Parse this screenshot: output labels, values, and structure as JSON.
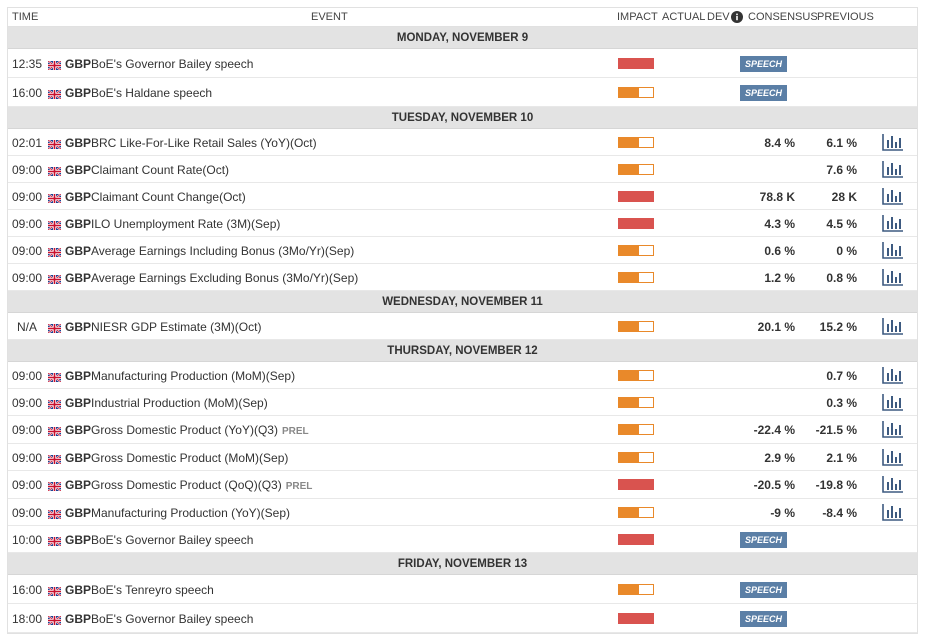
{
  "columns": {
    "time": "TIME",
    "event": "EVENT",
    "impact": "IMPACT",
    "actual": "ACTUAL",
    "dev": "DEV",
    "consensus": "CONSENSUS",
    "previous": "PREVIOUS"
  },
  "colors": {
    "impact_medium": "#e9892a",
    "impact_high": "#d9534f",
    "speech_badge": "#5b7fa6",
    "chart_icon": "#3d5a80",
    "day_header_bg": "#e3e3e3"
  },
  "groups": [
    {
      "day": "MONDAY, NOVEMBER 9",
      "events": [
        {
          "time": "12:35",
          "currency": "GBP",
          "name": "BoE's Governor Bailey speech",
          "tag": "",
          "impact": "high",
          "speech": "SPEECH",
          "consensus": "",
          "previous": "",
          "chart": false
        },
        {
          "time": "16:00",
          "currency": "GBP",
          "name": "BoE's Haldane speech",
          "tag": "",
          "impact": "medium",
          "speech": "SPEECH",
          "consensus": "",
          "previous": "",
          "chart": false
        }
      ]
    },
    {
      "day": "TUESDAY, NOVEMBER 10",
      "events": [
        {
          "time": "02:01",
          "currency": "GBP",
          "name": "BRC Like-For-Like Retail Sales (YoY)(Oct)",
          "tag": "",
          "impact": "medium",
          "speech": "",
          "consensus": "8.4 %",
          "previous": "6.1 %",
          "chart": true
        },
        {
          "time": "09:00",
          "currency": "GBP",
          "name": "Claimant Count Rate(Oct)",
          "tag": "",
          "impact": "medium",
          "speech": "",
          "consensus": "",
          "previous": "7.6 %",
          "chart": true
        },
        {
          "time": "09:00",
          "currency": "GBP",
          "name": "Claimant Count Change(Oct)",
          "tag": "",
          "impact": "high",
          "speech": "",
          "consensus": "78.8 K",
          "previous": "28 K",
          "chart": true
        },
        {
          "time": "09:00",
          "currency": "GBP",
          "name": "ILO Unemployment Rate (3M)(Sep)",
          "tag": "",
          "impact": "high",
          "speech": "",
          "consensus": "4.3 %",
          "previous": "4.5 %",
          "chart": true
        },
        {
          "time": "09:00",
          "currency": "GBP",
          "name": "Average Earnings Including Bonus (3Mo/Yr)(Sep)",
          "tag": "",
          "impact": "medium",
          "speech": "",
          "consensus": "0.6 %",
          "previous": "0 %",
          "chart": true
        },
        {
          "time": "09:00",
          "currency": "GBP",
          "name": "Average Earnings Excluding Bonus (3Mo/Yr)(Sep)",
          "tag": "",
          "impact": "medium",
          "speech": "",
          "consensus": "1.2 %",
          "previous": "0.8 %",
          "chart": true
        }
      ]
    },
    {
      "day": "WEDNESDAY, NOVEMBER 11",
      "events": [
        {
          "time": "N/A",
          "currency": "GBP",
          "name": "NIESR GDP Estimate (3M)(Oct)",
          "tag": "",
          "impact": "medium",
          "speech": "",
          "consensus": "20.1 %",
          "previous": "15.2 %",
          "chart": true
        }
      ]
    },
    {
      "day": "THURSDAY, NOVEMBER 12",
      "events": [
        {
          "time": "09:00",
          "currency": "GBP",
          "name": "Manufacturing Production (MoM)(Sep)",
          "tag": "",
          "impact": "medium",
          "speech": "",
          "consensus": "",
          "previous": "0.7 %",
          "chart": true
        },
        {
          "time": "09:00",
          "currency": "GBP",
          "name": "Industrial Production (MoM)(Sep)",
          "tag": "",
          "impact": "medium",
          "speech": "",
          "consensus": "",
          "previous": "0.3 %",
          "chart": true
        },
        {
          "time": "09:00",
          "currency": "GBP",
          "name": "Gross Domestic Product (YoY)(Q3)",
          "tag": "PREL",
          "impact": "medium",
          "speech": "",
          "consensus": "-22.4 %",
          "previous": "-21.5 %",
          "chart": true
        },
        {
          "time": "09:00",
          "currency": "GBP",
          "name": "Gross Domestic Product (MoM)(Sep)",
          "tag": "",
          "impact": "medium",
          "speech": "",
          "consensus": "2.9 %",
          "previous": "2.1 %",
          "chart": true
        },
        {
          "time": "09:00",
          "currency": "GBP",
          "name": "Gross Domestic Product (QoQ)(Q3)",
          "tag": "PREL",
          "impact": "high",
          "speech": "",
          "consensus": "-20.5 %",
          "previous": "-19.8 %",
          "chart": true
        },
        {
          "time": "09:00",
          "currency": "GBP",
          "name": "Manufacturing Production (YoY)(Sep)",
          "tag": "",
          "impact": "medium",
          "speech": "",
          "consensus": "-9 %",
          "previous": "-8.4 %",
          "chart": true
        },
        {
          "time": "10:00",
          "currency": "GBP",
          "name": "BoE's Governor Bailey speech",
          "tag": "",
          "impact": "high",
          "speech": "SPEECH",
          "consensus": "",
          "previous": "",
          "chart": false
        }
      ]
    },
    {
      "day": "FRIDAY, NOVEMBER 13",
      "events": [
        {
          "time": "16:00",
          "currency": "GBP",
          "name": "BoE's Tenreyro speech",
          "tag": "",
          "impact": "medium",
          "speech": "SPEECH",
          "consensus": "",
          "previous": "",
          "chart": false
        },
        {
          "time": "18:00",
          "currency": "GBP",
          "name": "BoE's Governor Bailey speech",
          "tag": "",
          "impact": "high",
          "speech": "SPEECH",
          "consensus": "",
          "previous": "",
          "chart": false
        }
      ]
    }
  ]
}
